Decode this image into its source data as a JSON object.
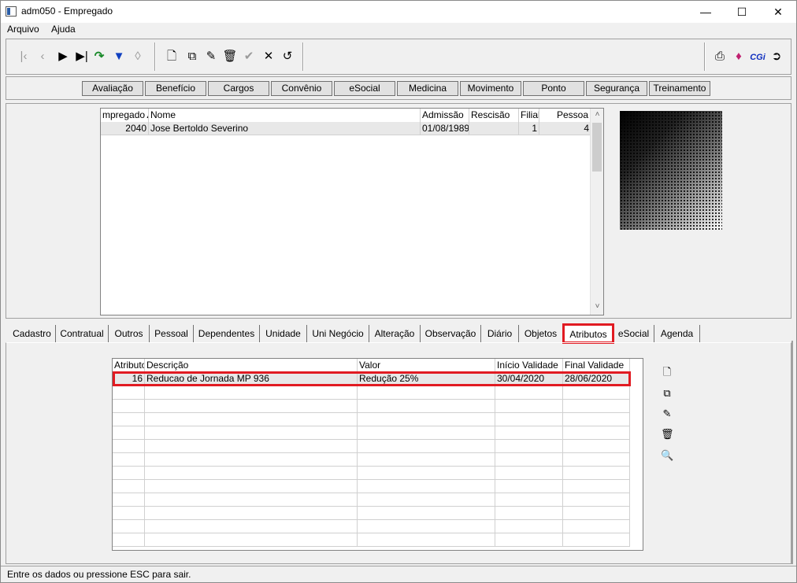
{
  "window": {
    "title": "adm050 - Empregado",
    "minimize": "—",
    "maximize": "☐",
    "close": "✕"
  },
  "menu": [
    "Arquivo",
    "Ajuda"
  ],
  "toolbar": {
    "nav_icons": [
      "first-icon",
      "prev-icon",
      "next-icon",
      "last-icon",
      "refresh-icon",
      "filter-icon",
      "clear-filter-icon"
    ],
    "edit_icons": [
      "new-icon",
      "copy-icon",
      "edit-icon",
      "delete-icon",
      "confirm-icon",
      "cancel-icon",
      "undo-icon"
    ],
    "right_icons": [
      "print-icon",
      "book-icon",
      "cgi-icon",
      "exit-icon"
    ],
    "cgi_label": "CGi"
  },
  "modules": [
    "Avaliação",
    "Benefício",
    "Cargos",
    "Convênio",
    "eSocial",
    "Medicina",
    "Movimento",
    "Ponto",
    "Segurança",
    "Treinamento"
  ],
  "employees": {
    "columns": [
      "mpregado",
      "Nome",
      "Admissão",
      "Rescisão",
      "Filial",
      "Pessoa"
    ],
    "rows": [
      {
        "empregado": "2040",
        "nome": "Jose Bertoldo Severino",
        "admissao": "01/08/1989",
        "rescisao": "",
        "filial": "1",
        "pessoa": "4"
      }
    ]
  },
  "tabs": [
    "Cadastro",
    "Contratual",
    "Outros",
    "Pessoal",
    "Dependentes",
    "Unidade",
    "Uni Negócio",
    "Alteração",
    "Observação",
    "Diário",
    "Objetos",
    "Atributos",
    "eSocial",
    "Agenda"
  ],
  "active_tab": "Atributos",
  "attributes": {
    "columns": [
      "Atributo",
      "Descrição",
      "Valor",
      "Início Validade",
      "Final Validade"
    ],
    "rows": [
      {
        "atributo": "16",
        "descricao": "Reducao de Jornada MP 936",
        "valor": "Redução 25%",
        "inicio": "30/04/2020",
        "final": "28/06/2020"
      }
    ]
  },
  "side_icons": [
    "new-icon",
    "copy-icon",
    "edit-icon",
    "delete-icon",
    "search-icon"
  ],
  "status": "Entre os dados ou pressione ESC para sair.",
  "colors": {
    "highlight": "#e11b22",
    "selected_row": "#e8e8e8"
  }
}
